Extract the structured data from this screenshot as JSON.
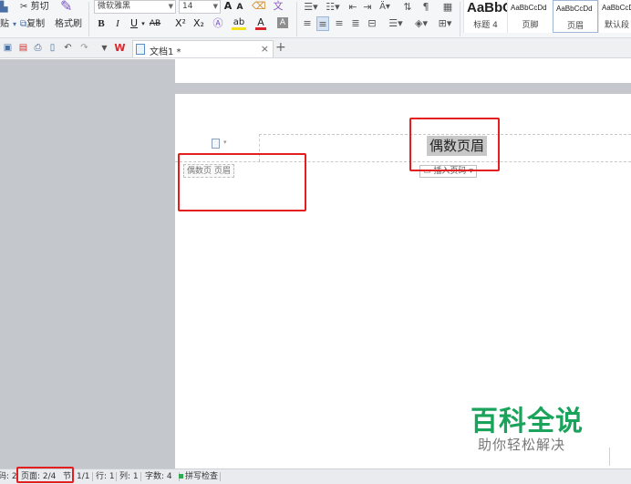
{
  "ribbon": {
    "clipboard": {
      "cut": "剪切",
      "paste": "贴",
      "copy": "复制",
      "format_painter": "格式刷"
    },
    "font": {
      "name": "微软雅黑",
      "size": "14",
      "bold": "B",
      "italic": "I",
      "underline": "U",
      "strike": "AB",
      "superscript": "X²",
      "subscript": "X₂",
      "grow": "A",
      "shrink": "A",
      "font_color": "A",
      "highlight": "ab"
    },
    "styles": [
      {
        "sample": "AaBbC",
        "name": "标题 4"
      },
      {
        "sample": "AaBbCcDd",
        "name": "页脚"
      },
      {
        "sample": "AaBbCcDd",
        "name": "页眉"
      },
      {
        "sample": "AaBbCcD",
        "name": "默认段"
      }
    ]
  },
  "tabs": {
    "doc_name": "文档1 *",
    "close": "×",
    "new": "+"
  },
  "page": {
    "header_tag": "偶数页 页眉",
    "header_text": "偶数页眉",
    "insert_page_number": "插入页码"
  },
  "watermark": {
    "title": "百科全说",
    "subtitle": "助你轻松解决"
  },
  "status": {
    "left_partial": "码: 2",
    "page": "页面: 2/4",
    "section_label": "节",
    "section": "1/1",
    "row": "行: 1",
    "col": "列: 1",
    "wordcount": "字数: 4",
    "spell": "拼写检查"
  },
  "colors": {
    "annotation": "#e21e1e",
    "watermark": "#19a35b"
  }
}
